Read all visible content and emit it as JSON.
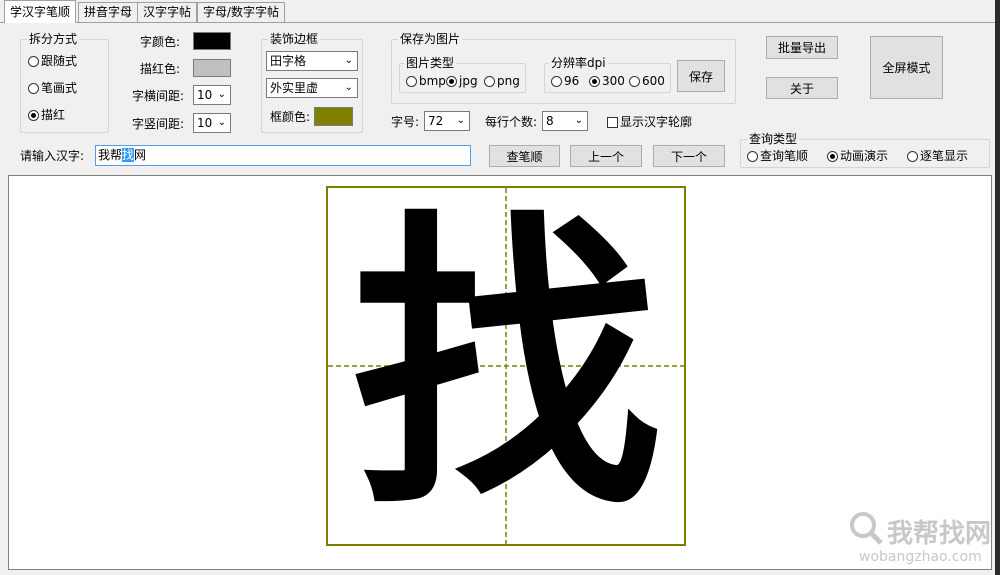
{
  "tabs": [
    "学汉字笔顺",
    "拼音字母",
    "汉字字帖",
    "字母/数字字帖"
  ],
  "split_group": {
    "title": "拆分方式",
    "options": [
      "跟随式",
      "笔画式",
      "描红"
    ],
    "selected": 2
  },
  "color_labels": {
    "char_color": "字颜色:",
    "trace_color": "描红色:",
    "h_spacing": "字横间距:",
    "v_spacing": "字竖间距:",
    "h_spacing_value": "10",
    "v_spacing_value": "10"
  },
  "colors": {
    "char": "#000000",
    "trace": "#c0c0c0",
    "frame": "#808000"
  },
  "border_group": {
    "title": "装饰边框",
    "grid_type": "田字格",
    "line_style": "外实里虚",
    "frame_color_label": "框颜色:"
  },
  "save_group": {
    "title": "保存为图片",
    "type_title": "图片类型",
    "types": [
      "bmp",
      "jpg",
      "png"
    ],
    "type_selected": 1,
    "dpi_title": "分辨率dpi",
    "dpis": [
      "96",
      "300",
      "600"
    ],
    "dpi_selected": 1,
    "save_btn": "保存"
  },
  "buttons": {
    "batch_export": "批量导出",
    "about": "关于",
    "fullscreen": "全屏模式",
    "check_order": "查笔顺",
    "prev": "上一个",
    "next": "下一个"
  },
  "font_row": {
    "size_label": "字号:",
    "size_value": "72",
    "per_row_label": "每行个数:",
    "per_row_value": "8",
    "outline_label": "显示汉字轮廓"
  },
  "input": {
    "label": "请输入汉字:",
    "before": "我帮",
    "selected": "找",
    "after": "网"
  },
  "query_group": {
    "title": "查询类型",
    "options": [
      "查询笔顺",
      "动画演示",
      "逐笔显示"
    ],
    "selected": 1
  },
  "display_char": "找",
  "watermark": {
    "main": "我帮找网",
    "sub": "wobangzhao.com"
  }
}
